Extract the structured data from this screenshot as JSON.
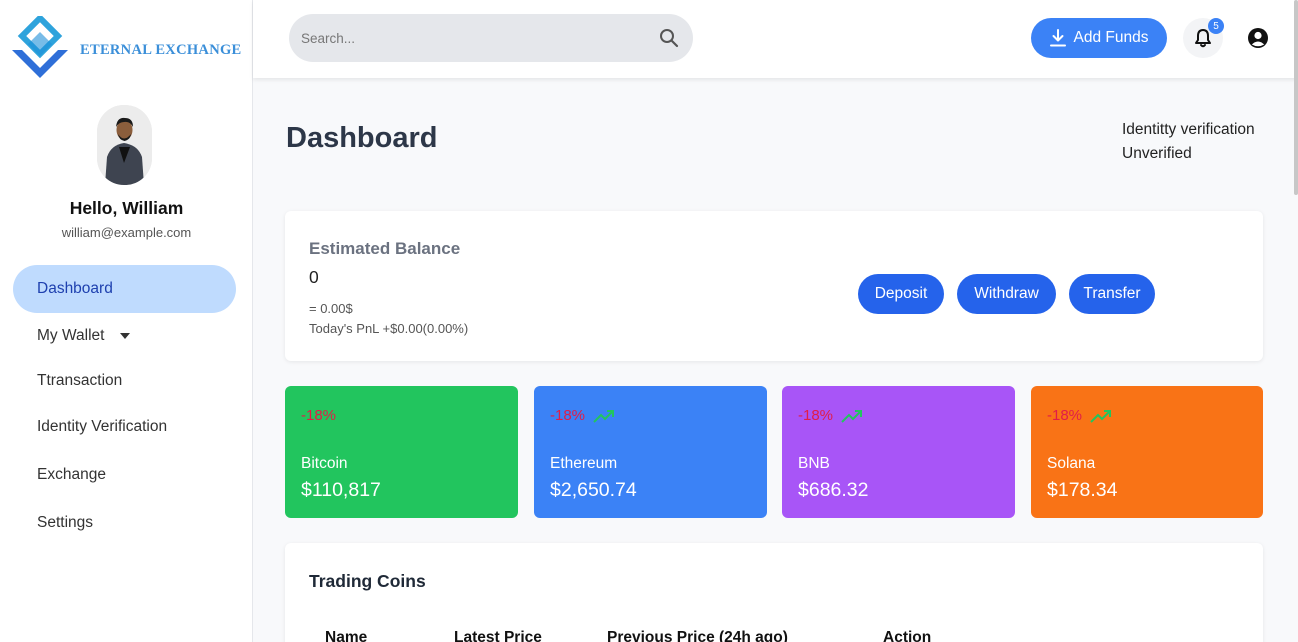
{
  "brand": {
    "name": "ETERNAL EXCHANGE"
  },
  "user": {
    "greeting": "Hello, William",
    "email": "william@example.com"
  },
  "sidebar": {
    "items": [
      {
        "label": "Dashboard"
      },
      {
        "label": "My Wallet"
      },
      {
        "label": "Ttransaction"
      },
      {
        "label": "Identity Verification"
      },
      {
        "label": "Exchange"
      },
      {
        "label": "Settings"
      }
    ]
  },
  "topbar": {
    "search_placeholder": "Search...",
    "add_funds_label": "Add Funds",
    "notification_count": "5"
  },
  "page": {
    "title": "Dashboard",
    "verification_label": "Identitty verification",
    "verification_status": "Unverified"
  },
  "balance": {
    "title": "Estimated Balance",
    "value": "0",
    "usd": "= 0.00$",
    "pnl": "Today's PnL +$0.00(0.00%)",
    "deposit_label": "Deposit",
    "withdraw_label": "Withdraw",
    "transfer_label": "Transfer"
  },
  "coins": [
    {
      "change": "-18%",
      "name": "Bitcoin",
      "price": "$110,817",
      "color": "#22c55e"
    },
    {
      "change": "-18%",
      "name": "Ethereum",
      "price": "$2,650.74",
      "color": "#3b82f6"
    },
    {
      "change": "-18%",
      "name": "BNB",
      "price": "$686.32",
      "color": "#a855f7"
    },
    {
      "change": "-18%",
      "name": "Solana",
      "price": "$178.34",
      "color": "#f97316"
    }
  ],
  "trading": {
    "title": "Trading Coins",
    "columns": [
      "Name",
      "Latest Price",
      "Previous Price (24h ago)",
      "Action"
    ]
  },
  "colors": {
    "accent": "#3b82f6",
    "button": "#2563eb",
    "active_nav_bg": "#bfdbfe",
    "trend_arrow": "#22c55e",
    "negative": "#e11d48"
  }
}
